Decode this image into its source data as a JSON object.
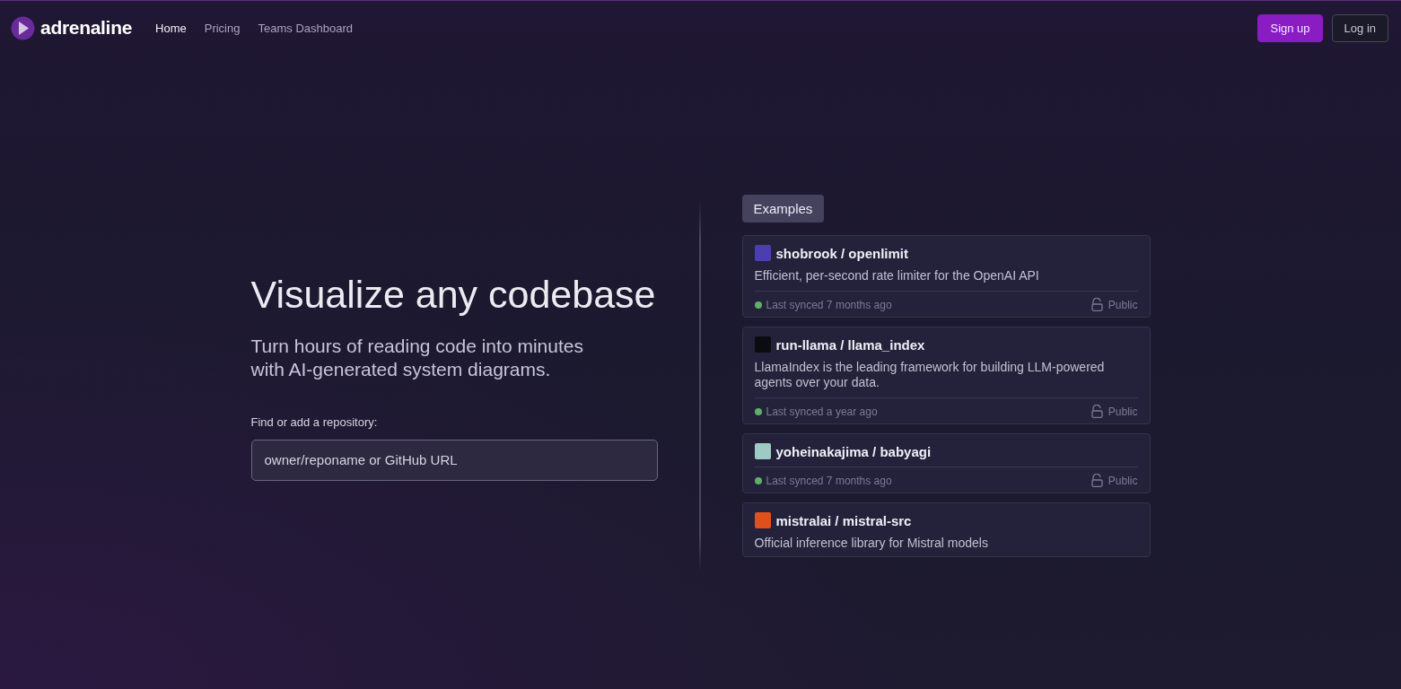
{
  "brand": {
    "name": "adrenaline"
  },
  "nav": [
    {
      "label": "Home",
      "selected": true
    },
    {
      "label": "Pricing",
      "selected": false
    },
    {
      "label": "Teams Dashboard",
      "selected": false
    }
  ],
  "auth_buttons": [
    {
      "label": "Sign up",
      "kind": "primary"
    },
    {
      "label": "Log in",
      "kind": "outline"
    }
  ],
  "hero": {
    "title": "Visualize any codebase",
    "subtitle": "Turn hours of reading code into minutes with AI-generated system diagrams.",
    "field_label": "Find or add a repository:",
    "search": {
      "placeholder": "owner/reponame or GitHub URL"
    }
  },
  "examples": {
    "heading": "Examples",
    "repos": [
      {
        "name": "shobrook / openlimit",
        "description": "Efficient, per-second rate limiter for the OpenAI API",
        "synced": "Last synced 7 months ago",
        "visibility": "Public",
        "color": "#4b3fb0"
      },
      {
        "name": "run-llama / llama_index",
        "description": "LlamaIndex is the leading framework for building LLM-powered agents over your data.",
        "synced": "Last synced a year ago",
        "visibility": "Public",
        "color": "#0b0b12"
      },
      {
        "name": "yoheinakajima / babyagi",
        "synced": "Last synced 7 months ago",
        "visibility": "Public",
        "color": "#9fc9c4"
      },
      {
        "name": "mistralai / mistral-src",
        "description": "Official inference library for Mistral models",
        "color": "#e0501a"
      }
    ]
  }
}
